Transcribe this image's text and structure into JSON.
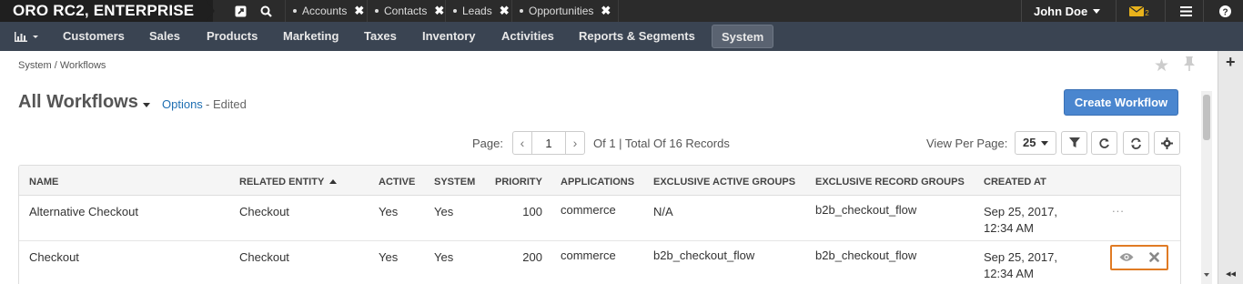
{
  "app": {
    "title": "ORO RC2, ENTERPRISE"
  },
  "quick_tabs": [
    {
      "label": "Accounts"
    },
    {
      "label": "Contacts"
    },
    {
      "label": "Leads"
    },
    {
      "label": "Opportunities"
    }
  ],
  "user": {
    "name": "John Doe",
    "mail_count": "2"
  },
  "nav": {
    "items": [
      "Customers",
      "Sales",
      "Products",
      "Marketing",
      "Taxes",
      "Inventory",
      "Activities",
      "Reports & Segments",
      "System"
    ],
    "active": "System"
  },
  "breadcrumb": [
    "System",
    "Workflows"
  ],
  "page": {
    "title": "All Workflows",
    "options_label": "Options",
    "edited_label": "- Edited",
    "create_button": "Create Workflow"
  },
  "pager": {
    "label": "Page:",
    "current": "1",
    "info": "Of 1 | Total Of 16 Records",
    "view_per_page_label": "View Per Page:",
    "view_per_page": "25"
  },
  "table": {
    "columns": [
      "Name",
      "Related Entity",
      "Active",
      "System",
      "Priority",
      "Applications",
      "Exclusive Active Groups",
      "Exclusive Record Groups",
      "Created At"
    ],
    "sorted_column": "Related Entity",
    "rows": [
      {
        "name": "Alternative Checkout",
        "entity": "Checkout",
        "active": "Yes",
        "system": "Yes",
        "priority": "100",
        "applications": "commerce",
        "active_groups": "N/A",
        "record_groups": "b2b_checkout_flow",
        "created_line1": "Sep 25, 2017,",
        "created_line2": "12:34 AM",
        "actions_label": "..."
      },
      {
        "name": "Checkout",
        "entity": "Checkout",
        "active": "Yes",
        "system": "Yes",
        "priority": "200",
        "applications": "commerce",
        "active_groups": "b2b_checkout_flow",
        "record_groups": "b2b_checkout_flow",
        "created_line1": "Sep 25, 2017,",
        "created_line2": "12:34 AM"
      }
    ]
  },
  "colors": {
    "primary": "#4a86cf",
    "nav_bg": "#3a4452",
    "topbar_bg": "#2b2b2b",
    "highlight": "#e07b24",
    "link": "#1f6fb2"
  }
}
